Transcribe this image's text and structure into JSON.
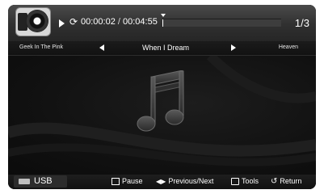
{
  "player": {
    "elapsed": "00:00:02",
    "time_separator": "/",
    "total": "00:04:55",
    "progress_fraction": 0.007,
    "track_count": "1/3",
    "icons": {
      "play": "play-icon",
      "repeat": "repeat-icon",
      "album": "album-art-icon"
    }
  },
  "tracks": {
    "previous": "Geek In The Pink",
    "current": "When I Dream",
    "next": "Heaven"
  },
  "bottom": {
    "source": "USB",
    "pause": "Pause",
    "prev_next": "Previous/Next",
    "tools": "Tools",
    "return": "Return"
  },
  "colors": {
    "background": "#101010",
    "accent": "#ffffff"
  }
}
